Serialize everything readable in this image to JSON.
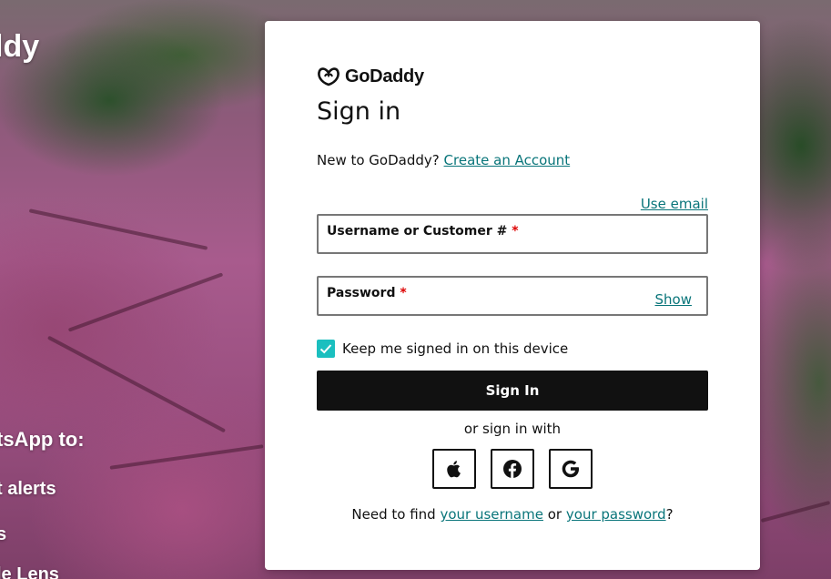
{
  "background": {
    "brand_partial": "ldy",
    "line1": "tsApp to:",
    "line2": "t alerts",
    "line3": "s",
    "line4": "le Lens"
  },
  "login": {
    "brand": "GoDaddy",
    "title": "Sign in",
    "new_prompt": "New to GoDaddy?",
    "create_account": "Create an Account",
    "use_email": "Use email",
    "username_label": "Username or Customer #",
    "password_label": "Password",
    "required_mark": "*",
    "show": "Show",
    "keep_signed_in": "Keep me signed in on this device",
    "keep_signed_in_checked": true,
    "sign_in_button": "Sign In",
    "or_sign_in_with": "or sign in with",
    "social_icons": [
      "apple-icon",
      "facebook-icon",
      "google-icon"
    ],
    "help_prefix": "Need to find",
    "your_username": "your username",
    "help_or": "or",
    "your_password": "your password",
    "help_suffix": "?"
  },
  "colors": {
    "link": "#09757a",
    "checkbox": "#1bbfbf",
    "button": "#111111",
    "required": "#dd0000"
  }
}
